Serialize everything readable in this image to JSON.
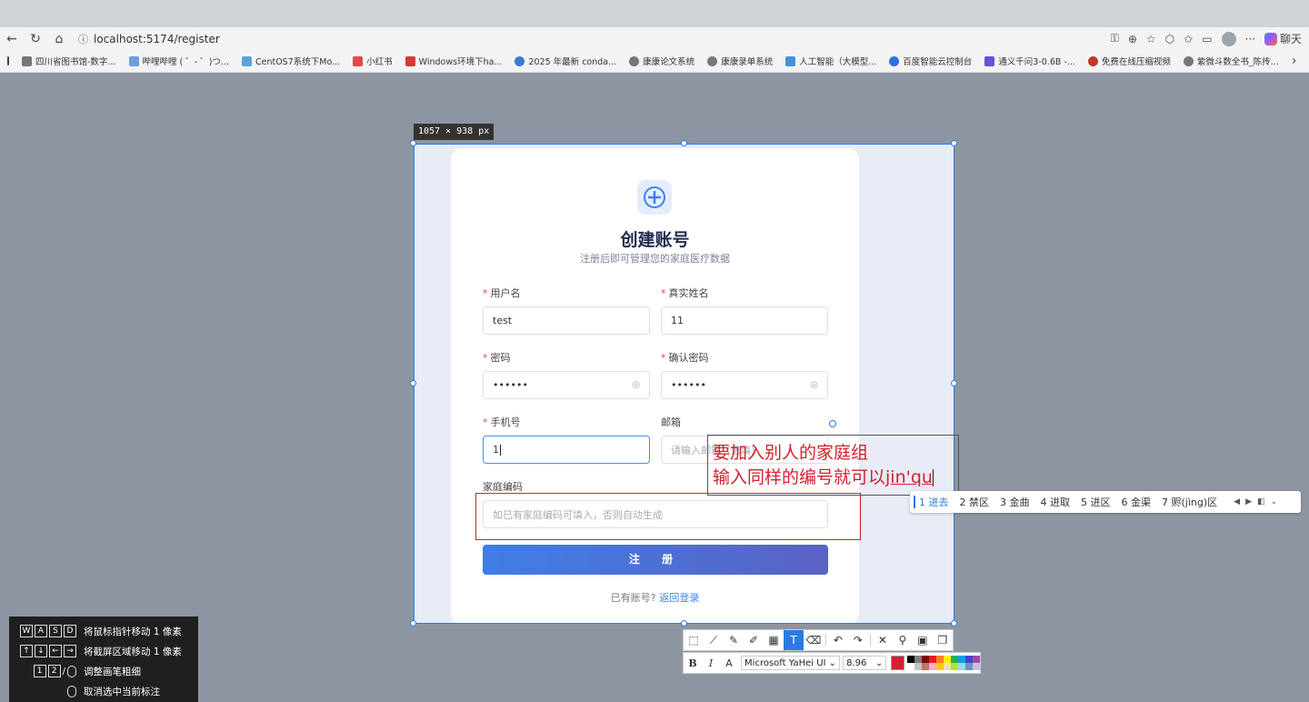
{
  "browser": {
    "url": "localhost:5174/register",
    "copilot_label": "聊天"
  },
  "bookmarks": [
    {
      "label": "四川省图书馆-数字..."
    },
    {
      "label": "哔哩哔哩 ( ゜- ゜)つ..."
    },
    {
      "label": "CentOS7系统下Mo..."
    },
    {
      "label": "小红书"
    },
    {
      "label": "Windows环境下ha..."
    },
    {
      "label": "2025 年最新 conda..."
    },
    {
      "label": "康康论文系统"
    },
    {
      "label": "康康录单系统"
    },
    {
      "label": "人工智能（大模型..."
    },
    {
      "label": "百度智能云控制台"
    },
    {
      "label": "通义千问3-0.6B -..."
    },
    {
      "label": "免费在线压缩视频"
    },
    {
      "label": "紫微斗数全书_陈抟..."
    }
  ],
  "selection_size": "1057 × 938  px",
  "form": {
    "title": "创建账号",
    "subtitle": "注册后即可管理您的家庭医疗数据",
    "username": {
      "label": "用户名",
      "value": "test"
    },
    "realname": {
      "label": "真实姓名",
      "value": "11"
    },
    "password": {
      "label": "密码",
      "value": "••••••"
    },
    "confirm_password": {
      "label": "确认密码",
      "value": "••••••"
    },
    "phone": {
      "label": "手机号",
      "value": "1"
    },
    "email": {
      "label": "邮箱",
      "placeholder": "请输入邮箱（选填）"
    },
    "family_code": {
      "label": "家庭编码",
      "placeholder": "如已有家庭编码可填入，否则自动生成"
    },
    "submit_label": "注 册",
    "has_account": "已有账号?",
    "back_login": "返回登录"
  },
  "annotation": {
    "line1": "要加入别人的家庭组",
    "line2_prefix": "输入同样的编号就可以",
    "line2_composing": "jin'qu",
    "color": "#d4202d"
  },
  "ime_candidates": [
    "1 进去",
    "2 禁区",
    "3 金曲",
    "4 进取",
    "5 进区",
    "6 金渠",
    "7 赆(jìng)区"
  ],
  "format_toolbar": {
    "font": "Microsoft YaHei UI",
    "size": "8.96",
    "current_color": "#d4202d"
  },
  "help": [
    {
      "keys": [
        "W",
        "A",
        "S",
        "D"
      ],
      "text": "将鼠标指针移动 1 像素"
    },
    {
      "keys": [
        "↑",
        "↓",
        "←",
        "→"
      ],
      "text": "将截屏区域移动 1 像素"
    },
    {
      "keys": [
        "1",
        "2"
      ],
      "text": "调整画笔粗细"
    },
    {
      "keys": [],
      "text": "取消选中当前标注"
    }
  ]
}
